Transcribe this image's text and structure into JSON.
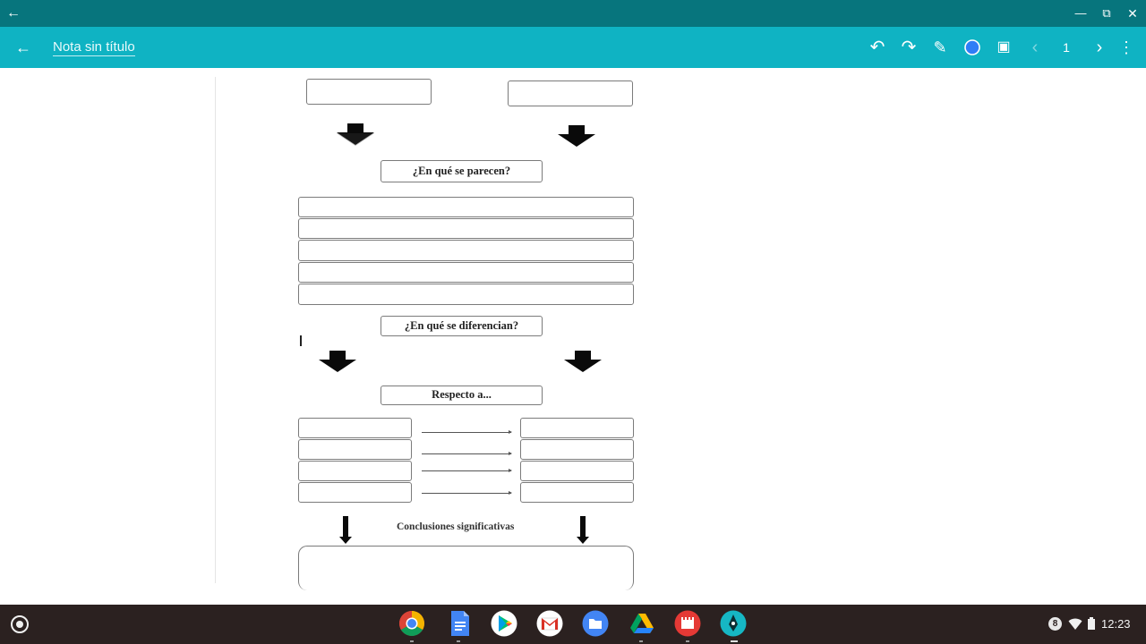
{
  "window": {
    "back_glyph": "←",
    "minimize_glyph": "—",
    "restore_glyph": "⧉",
    "close_glyph": "✕"
  },
  "toolbar": {
    "title": "Nota sin título",
    "back_glyph": "←",
    "undo_glyph": "↶",
    "redo_glyph": "↷",
    "pen_glyph": "✎",
    "image_glyph": "▣",
    "prev_page_glyph": "‹",
    "page_number": "1",
    "add_page_glyph": "›",
    "more_glyph": "⋮",
    "color_accent": "#2f7df6"
  },
  "document": {
    "q_similar": "¿En qué se parecen?",
    "q_different": "¿En qué se diferencian?",
    "respect": "Respecto a...",
    "conclusions": "Conclusiones significativas"
  },
  "shelf": {
    "apps": [
      "chrome",
      "docs",
      "play-store",
      "gmail",
      "files",
      "drive",
      "video-player",
      "pen-app"
    ],
    "notification_count": "8",
    "time": "12:23"
  }
}
